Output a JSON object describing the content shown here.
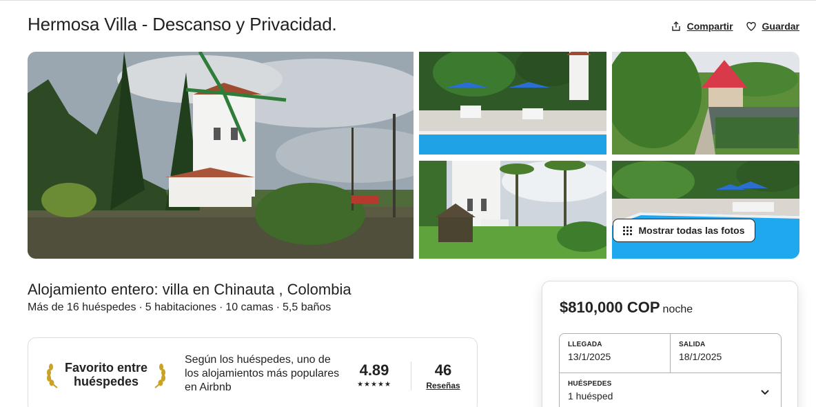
{
  "header": {
    "title": "Hermosa Villa - Descanso y Privacidad.",
    "share_label": "Compartir",
    "save_label": "Guardar"
  },
  "gallery": {
    "show_all_label": "Mostrar todas las fotos"
  },
  "listing": {
    "subtitle": "Alojamiento entero: villa en Chinauta , Colombia",
    "details": [
      "Más de 16 huéspedes",
      "5 habitaciones",
      "10 camas",
      "5,5 baños"
    ],
    "separator": "·"
  },
  "favorite": {
    "title": "Favorito entre huéspedes",
    "description": "Según los huéspedes, uno de los alojamientos más populares en Airbnb",
    "rating": "4.89",
    "stars": "★★★★★",
    "reviews_count": "46",
    "reviews_label": "Reseñas"
  },
  "booking": {
    "price": "$810,000 COP",
    "price_unit": "noche",
    "checkin_label": "LLEGADA",
    "checkin_value": "13/1/2025",
    "checkout_label": "SALIDA",
    "checkout_value": "18/1/2025",
    "guests_label": "HUÉSPEDES",
    "guests_value": "1 huésped"
  },
  "icons": {
    "share": "share-icon",
    "save": "heart-icon",
    "grid": "grid-icon",
    "laurel": "laurel-icon",
    "chevron": "chevron-down-icon"
  },
  "colors": {
    "text": "#222222",
    "border": "#dddddd",
    "laurel_gold": "#c9a227"
  }
}
